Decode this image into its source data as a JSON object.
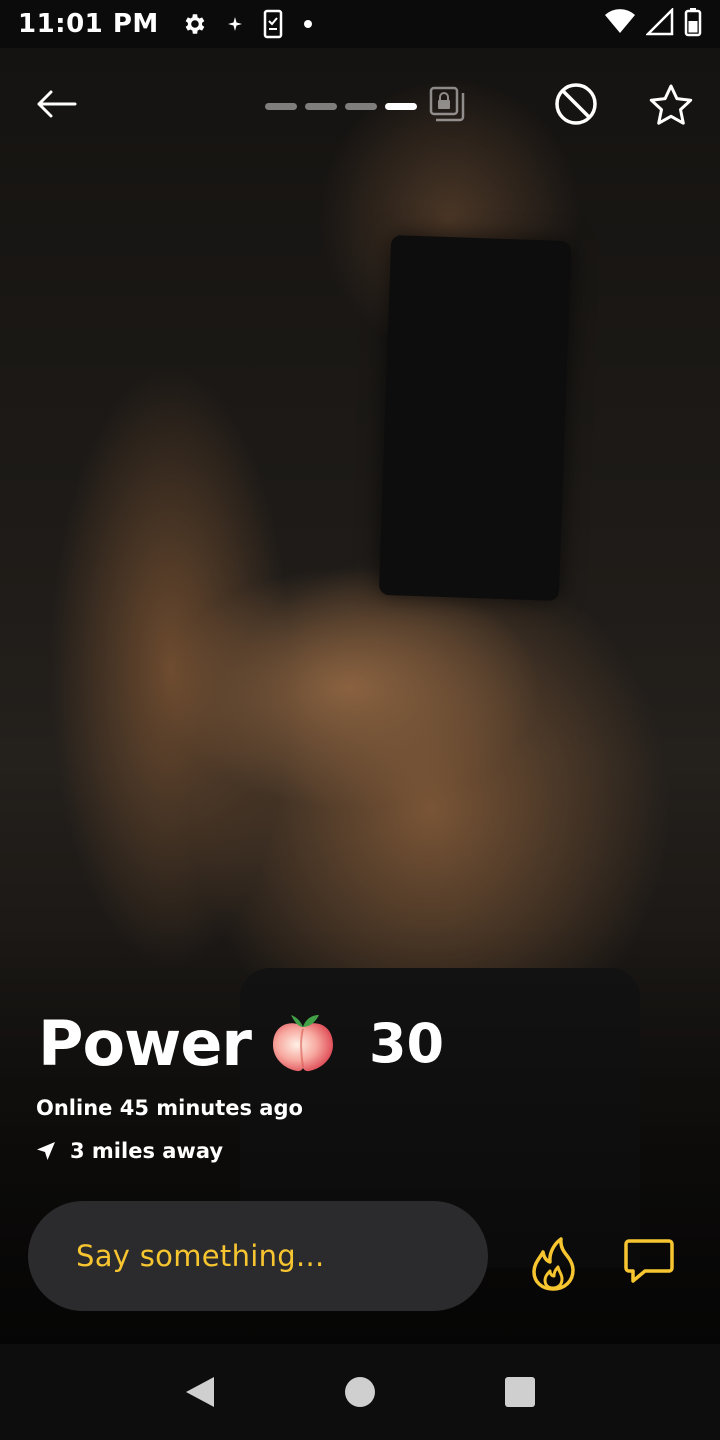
{
  "status_bar": {
    "time": "11:01 PM",
    "icons": [
      "settings-icon",
      "sparkle-icon",
      "phone-task-icon",
      "dot-icon",
      "wifi-icon",
      "cell-signal-icon",
      "battery-icon"
    ]
  },
  "top_bar": {
    "back_icon": "arrow-left-icon",
    "photo_pager": {
      "count": 4,
      "active_index": 3,
      "extra_icon": "locked-album-icon"
    },
    "block_icon": "block-icon",
    "favorite_icon": "star-outline-icon"
  },
  "profile": {
    "name": "Power",
    "emoji": "🍑",
    "age": "30",
    "online_status": "Online 45 minutes ago",
    "distance": "3 miles away"
  },
  "actions": {
    "message_placeholder": "Say something...",
    "tap_icon": "flame-icon",
    "chat_icon": "chat-bubble-icon",
    "accent_color": "#f7c530"
  },
  "nav_bar": {
    "icons": [
      "nav-back-icon",
      "nav-home-icon",
      "nav-recents-icon"
    ]
  }
}
